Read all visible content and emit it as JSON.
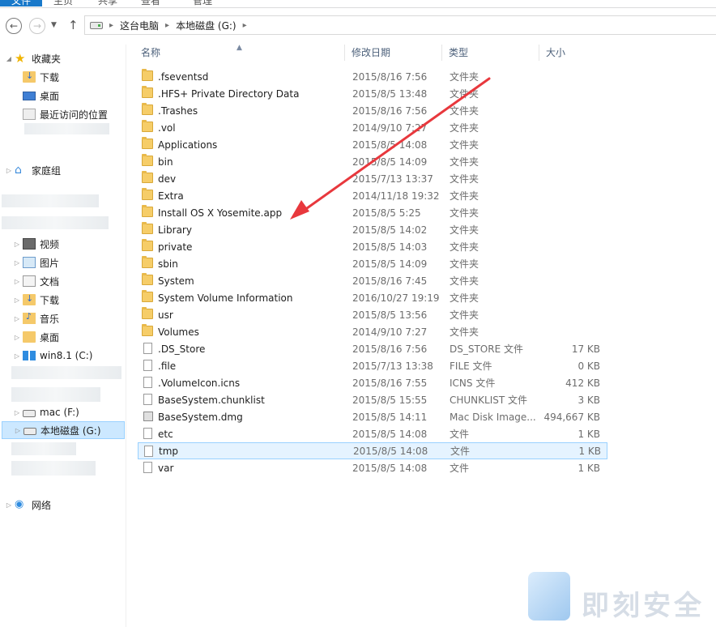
{
  "ribbon": {
    "tabs": [
      "文件",
      "主页",
      "共享",
      "查看",
      "管理"
    ]
  },
  "address": {
    "crumbs": [
      "这台电脑",
      "本地磁盘 (G:)"
    ]
  },
  "sidebar": {
    "favorites": "收藏夹",
    "downloads": "下载",
    "desktop": "桌面",
    "recent": "最近访问的位置",
    "homegroup": "家庭组",
    "pc_items": [
      "视频",
      "图片",
      "文档",
      "下载",
      "音乐",
      "桌面",
      "win8.1 (C:)"
    ],
    "mac": "mac (F:)",
    "local": "本地磁盘 (G:)",
    "network": "网络"
  },
  "columns": {
    "name": "名称",
    "date": "修改日期",
    "type": "类型",
    "size": "大小"
  },
  "files": [
    {
      "name": ".fseventsd",
      "date": "2015/8/16 7:56",
      "type": "文件夹",
      "size": "",
      "icon": "folder"
    },
    {
      "name": ".HFS+ Private Directory Data",
      "date": "2015/8/5 13:48",
      "type": "文件夹",
      "size": "",
      "icon": "folder"
    },
    {
      "name": ".Trashes",
      "date": "2015/8/16 7:56",
      "type": "文件夹",
      "size": "",
      "icon": "folder"
    },
    {
      "name": ".vol",
      "date": "2014/9/10 7:27",
      "type": "文件夹",
      "size": "",
      "icon": "folder"
    },
    {
      "name": "Applications",
      "date": "2015/8/5 14:08",
      "type": "文件夹",
      "size": "",
      "icon": "folder"
    },
    {
      "name": "bin",
      "date": "2015/8/5 14:09",
      "type": "文件夹",
      "size": "",
      "icon": "folder"
    },
    {
      "name": "dev",
      "date": "2015/7/13 13:37",
      "type": "文件夹",
      "size": "",
      "icon": "folder"
    },
    {
      "name": "Extra",
      "date": "2014/11/18 19:32",
      "type": "文件夹",
      "size": "",
      "icon": "folder"
    },
    {
      "name": "Install OS X Yosemite.app",
      "date": "2015/8/5 5:25",
      "type": "文件夹",
      "size": "",
      "icon": "folder"
    },
    {
      "name": "Library",
      "date": "2015/8/5 14:02",
      "type": "文件夹",
      "size": "",
      "icon": "folder"
    },
    {
      "name": "private",
      "date": "2015/8/5 14:03",
      "type": "文件夹",
      "size": "",
      "icon": "folder"
    },
    {
      "name": "sbin",
      "date": "2015/8/5 14:09",
      "type": "文件夹",
      "size": "",
      "icon": "folder"
    },
    {
      "name": "System",
      "date": "2015/8/16 7:45",
      "type": "文件夹",
      "size": "",
      "icon": "folder"
    },
    {
      "name": "System Volume Information",
      "date": "2016/10/27 19:19",
      "type": "文件夹",
      "size": "",
      "icon": "folder"
    },
    {
      "name": "usr",
      "date": "2015/8/5 13:56",
      "type": "文件夹",
      "size": "",
      "icon": "folder"
    },
    {
      "name": "Volumes",
      "date": "2014/9/10 7:27",
      "type": "文件夹",
      "size": "",
      "icon": "folder"
    },
    {
      "name": ".DS_Store",
      "date": "2015/8/16 7:56",
      "type": "DS_STORE 文件",
      "size": "17 KB",
      "icon": "file"
    },
    {
      "name": ".file",
      "date": "2015/7/13 13:38",
      "type": "FILE 文件",
      "size": "0 KB",
      "icon": "file"
    },
    {
      "name": ".VolumeIcon.icns",
      "date": "2015/8/16 7:55",
      "type": "ICNS 文件",
      "size": "412 KB",
      "icon": "file"
    },
    {
      "name": "BaseSystem.chunklist",
      "date": "2015/8/5 15:55",
      "type": "CHUNKLIST 文件",
      "size": "3 KB",
      "icon": "file"
    },
    {
      "name": "BaseSystem.dmg",
      "date": "2015/8/5 14:11",
      "type": "Mac Disk Image...",
      "size": "494,667 KB",
      "icon": "dmg"
    },
    {
      "name": "etc",
      "date": "2015/8/5 14:08",
      "type": "文件",
      "size": "1 KB",
      "icon": "file"
    },
    {
      "name": "tmp",
      "date": "2015/8/5 14:08",
      "type": "文件",
      "size": "1 KB",
      "icon": "file",
      "selected": true
    },
    {
      "name": "var",
      "date": "2015/8/5 14:08",
      "type": "文件",
      "size": "1 KB",
      "icon": "file"
    }
  ],
  "watermark": "即刻安全",
  "colors": {
    "selection": "#cce8ff",
    "annotation_arrow": "#e8383d",
    "folder": "#f6cd68"
  }
}
